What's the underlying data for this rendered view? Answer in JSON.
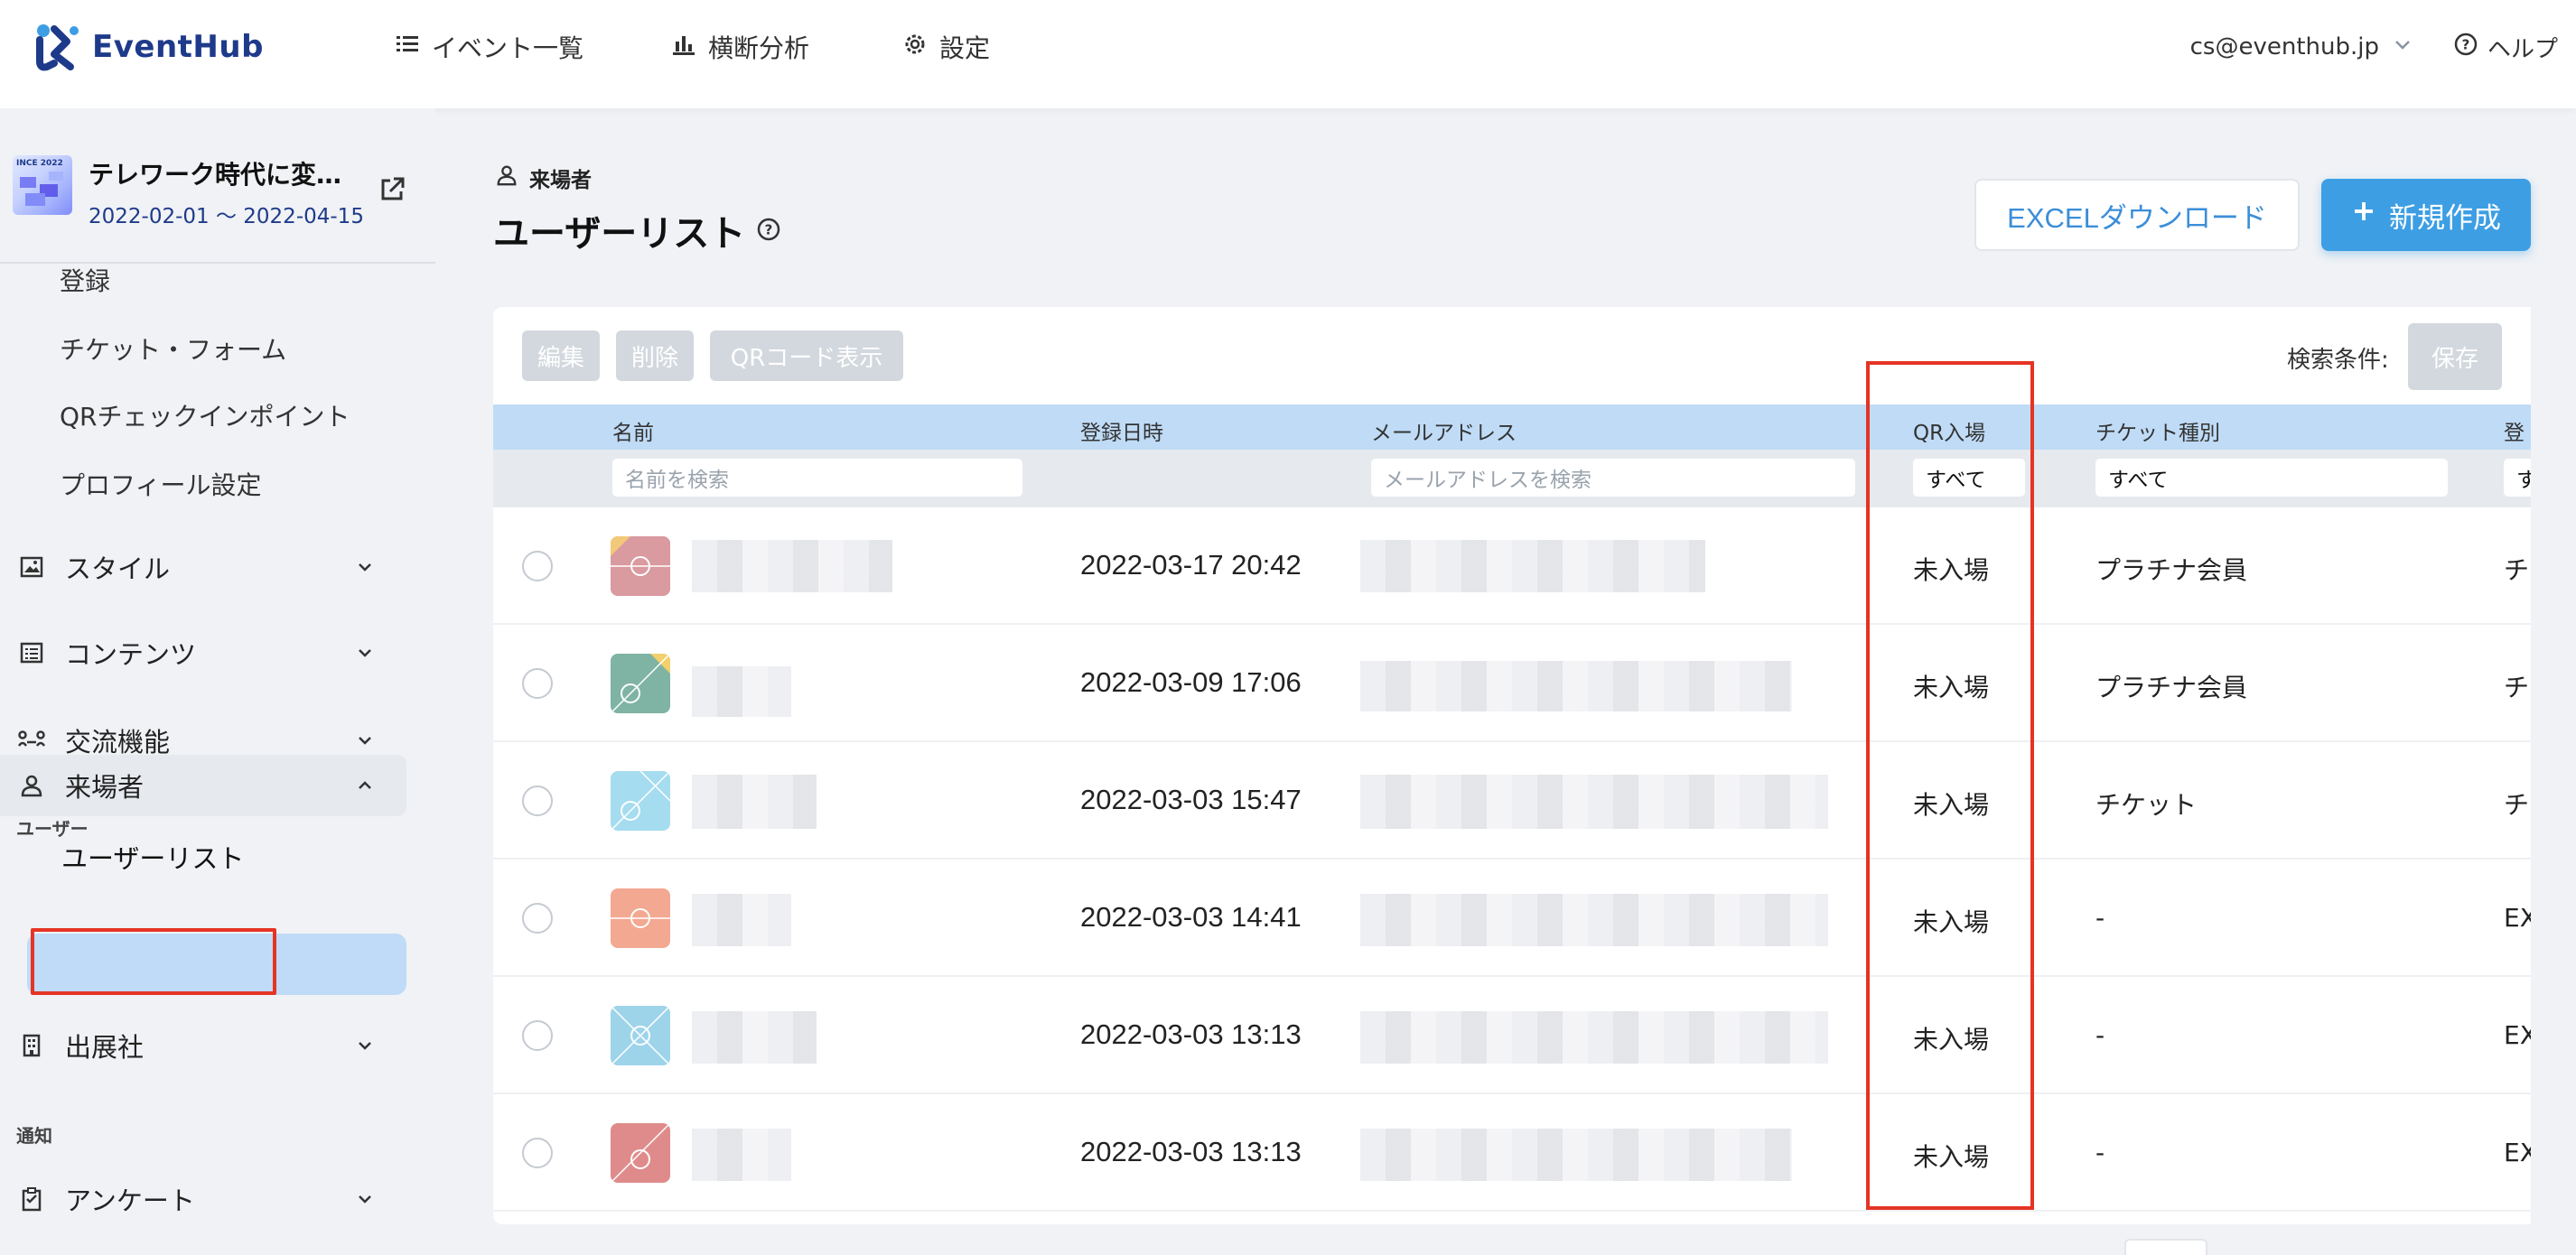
{
  "app": {
    "name": "EventHub",
    "brand_color": "#1e3a8a",
    "accent_color": "#3d9ee4",
    "highlight_color": "#e53424"
  },
  "topnav": {
    "items": [
      {
        "label": "イベント一覧",
        "icon": "list-icon"
      },
      {
        "label": "横断分析",
        "icon": "bar-chart-icon"
      },
      {
        "label": "設定",
        "icon": "gear-icon"
      }
    ],
    "user_email": "cs@eventhub.jp",
    "help_label": "ヘルプ"
  },
  "event": {
    "title": "テレワーク時代に変…",
    "dates": "2022-02-01 ～ 2022-04-15",
    "thumb_text": "INCE 2022"
  },
  "sidebar": {
    "sub_items": [
      "登録",
      "チケット・フォーム",
      "QRチェックインポイント",
      "プロフィール設定"
    ],
    "groups": [
      {
        "label": "スタイル",
        "icon": "image-icon"
      },
      {
        "label": "コンテンツ",
        "icon": "document-list-icon"
      },
      {
        "label": "交流機能",
        "icon": "network-icon"
      }
    ],
    "section_user": "ユーザー",
    "visitor_label": "来場者",
    "user_list_label": "ユーザーリスト",
    "exhibitor_label": "出展社",
    "section_notice": "通知",
    "survey_label": "アンケート"
  },
  "main": {
    "breadcrumb": "来場者",
    "title": "ユーザーリスト",
    "excel_button": "EXCELダウンロード",
    "new_button": "新規作成",
    "toolbar": {
      "edit": "編集",
      "delete": "削除",
      "qr": "QRコード表示",
      "search_conditions": "検索条件:",
      "save": "保存"
    },
    "table": {
      "columns": [
        "名前",
        "登録日時",
        "メールアドレス",
        "QR入場",
        "チケット種別",
        "登"
      ],
      "filters": {
        "name_placeholder": "名前を検索",
        "email_placeholder": "メールアドレスを検索",
        "qr_value": "すべて",
        "ticket_value": "すべて",
        "extra_value": "す"
      },
      "rows": [
        {
          "date": "2022-03-17 20:42",
          "qr": "未入場",
          "ticket": "プラチナ会員",
          "extra": "チ"
        },
        {
          "date": "2022-03-09 17:06",
          "qr": "未入場",
          "ticket": "プラチナ会員",
          "extra": "チ"
        },
        {
          "date": "2022-03-03 15:47",
          "qr": "未入場",
          "ticket": "チケット",
          "extra": "チ"
        },
        {
          "date": "2022-03-03 14:41",
          "qr": "未入場",
          "ticket": "-",
          "extra": "EX"
        },
        {
          "date": "2022-03-03 13:13",
          "qr": "未入場",
          "ticket": "-",
          "extra": "EX"
        },
        {
          "date": "2022-03-03 13:13",
          "qr": "未入場",
          "ticket": "-",
          "extra": "EX"
        }
      ]
    }
  }
}
